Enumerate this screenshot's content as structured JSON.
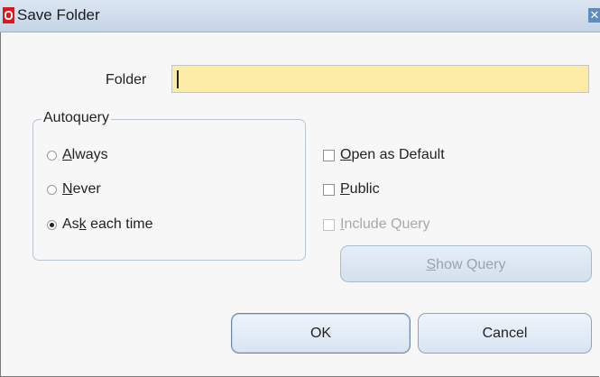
{
  "window": {
    "title": "Save Folder",
    "close_glyph": "✕"
  },
  "form": {
    "folder_label": "Folder",
    "folder_value": "",
    "autoquery": {
      "title": "Autoquery",
      "options": [
        {
          "pre": "",
          "key": "A",
          "post": "lways",
          "selected": false
        },
        {
          "pre": "",
          "key": "N",
          "post": "ever",
          "selected": false
        },
        {
          "pre": "As",
          "key": "k",
          "post": " each time",
          "selected": true
        }
      ]
    },
    "checks": [
      {
        "pre": "",
        "key": "O",
        "post": "pen as Default",
        "checked": false,
        "enabled": true
      },
      {
        "pre": "",
        "key": "P",
        "post": "ublic",
        "checked": false,
        "enabled": true
      },
      {
        "pre": "",
        "key": "I",
        "post": "nclude Query",
        "checked": false,
        "enabled": false
      }
    ],
    "show_query": {
      "key": "S",
      "post": "how Query",
      "enabled": false
    }
  },
  "buttons": {
    "ok": "OK",
    "cancel": "Cancel"
  },
  "colors": {
    "input_bg": "#fdeca6",
    "title_bar": "#c4d3e6",
    "icon_red": "#e0161b"
  }
}
